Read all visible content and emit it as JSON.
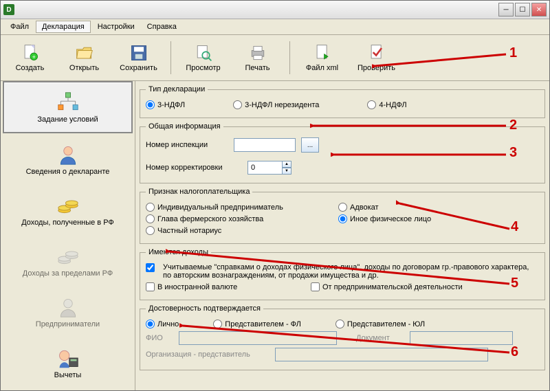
{
  "titlebar": {
    "title": ""
  },
  "menu": {
    "file": "Файл",
    "declaration": "Декларация",
    "settings": "Настройки",
    "help": "Справка"
  },
  "toolbar": {
    "create": "Создать",
    "open": "Открыть",
    "save": "Сохранить",
    "preview": "Просмотр",
    "print": "Печать",
    "xml": "Файл xml",
    "check": "Проверить"
  },
  "sidebar": {
    "conditions": "Задание условий",
    "declarant": "Сведения о декларанте",
    "income_rf": "Доходы, полученные в РФ",
    "income_abroad": "Доходы за пределами РФ",
    "entrepreneurs": "Предприниматели",
    "deductions": "Вычеты"
  },
  "groups": {
    "decl_type": "Тип декларации",
    "general": "Общая информация",
    "taxpayer": "Признак налогоплательщика",
    "income": "Имеются доходы",
    "authenticity": "Достоверность подтверждается"
  },
  "decl_type": {
    "opt1": "3-НДФЛ",
    "opt2": "3-НДФЛ нерезидента",
    "opt3": "4-НДФЛ"
  },
  "general": {
    "inspection_label": "Номер инспекции",
    "inspection_value": "",
    "correction_label": "Номер корректировки",
    "correction_value": "0"
  },
  "taxpayer": {
    "opt1": "Индивидуальный предприниматель",
    "opt2": "Адвокат",
    "opt3": "Глава фермерского хозяйства",
    "opt4": "Иное физическое лицо",
    "opt5": "Частный нотариус"
  },
  "income": {
    "opt1": "Учитываемые \"справками о доходах физического лица\", доходы по договорам гр.-правового характера, по авторским вознаграждениям, от продажи имущества и др.",
    "opt2": "В иностранной валюте",
    "opt3": "От предпринимательской деятельности"
  },
  "auth": {
    "opt1": "Лично",
    "opt2": "Представителем - ФЛ",
    "opt3": "Представителем - ЮЛ",
    "fio_label": "ФИО",
    "doc_label": "Документ",
    "org_label": "Организация - представитель"
  },
  "annot": {
    "n1": "1",
    "n2": "2",
    "n3": "3",
    "n4": "4",
    "n5": "5",
    "n6": "6"
  }
}
